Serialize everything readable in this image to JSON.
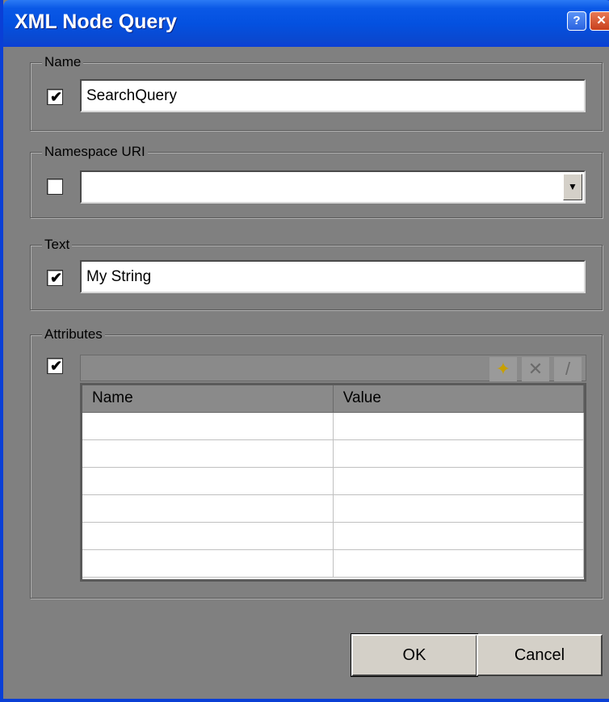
{
  "window": {
    "title": "XML Node Query",
    "help_glyph": "?",
    "close_glyph": "✕"
  },
  "name_group": {
    "legend": "Name",
    "checked": true,
    "value": "SearchQuery"
  },
  "namespace_group": {
    "legend": "Namespace URI",
    "checked": false,
    "value": ""
  },
  "text_group": {
    "legend": "Text",
    "checked": true,
    "value": "My String"
  },
  "attributes_group": {
    "legend": "Attributes",
    "checked": true,
    "toolbar": [
      "new-icon",
      "delete-icon",
      "edit-icon"
    ],
    "columns": [
      "Name",
      "Value"
    ],
    "rows": [
      [
        "",
        ""
      ],
      [
        "",
        ""
      ],
      [
        "",
        ""
      ],
      [
        "",
        ""
      ],
      [
        "",
        ""
      ],
      [
        "",
        ""
      ]
    ]
  },
  "buttons": {
    "ok": "OK",
    "cancel": "Cancel"
  }
}
